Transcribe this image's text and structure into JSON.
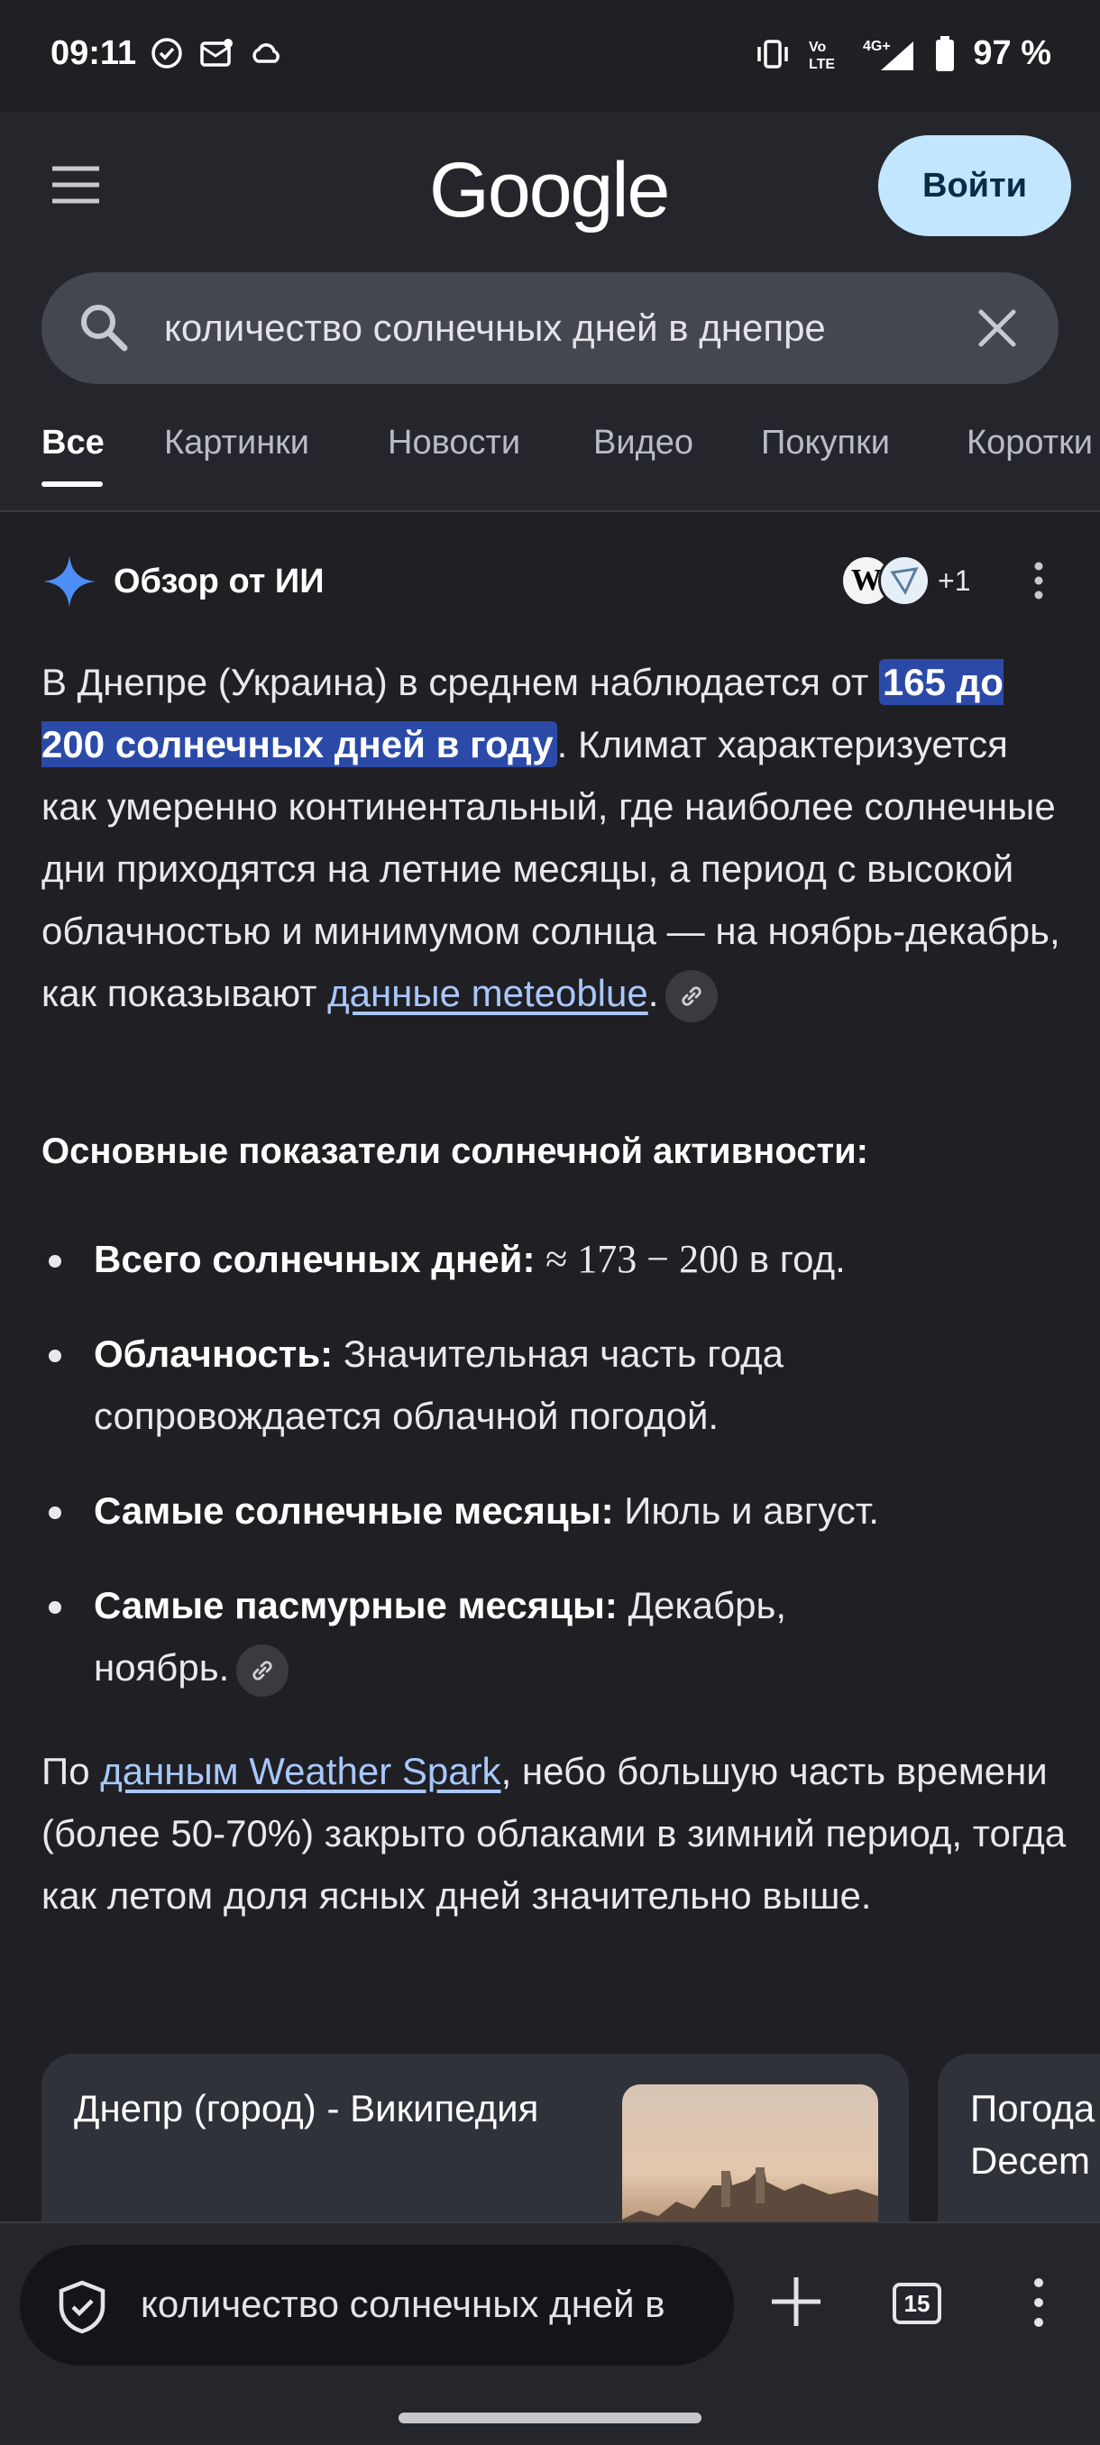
{
  "status_bar": {
    "time": "09:11",
    "battery": "97 %",
    "network": "4G+",
    "volte": "Vo LTE"
  },
  "header": {
    "logo": "Google",
    "signin_label": "Войти"
  },
  "search": {
    "query": "количество солнечных дней в днепре"
  },
  "tabs": [
    {
      "label": "Все",
      "active": true
    },
    {
      "label": "Картинки"
    },
    {
      "label": "Новости"
    },
    {
      "label": "Видео"
    },
    {
      "label": "Покупки"
    },
    {
      "label": "Коротки"
    }
  ],
  "ai_overview": {
    "title": "Обзор от ИИ",
    "sources_more": "+1",
    "intro_before": "В Днепре (Украина) в среднем наблюдается от ",
    "intro_highlight": "165 до 200 солнечных дней в году",
    "intro_after": ". Климат характеризуется как умеренно континентальный, где наиболее солнечные дни приходятся на летние месяцы, а период с высокой облачностью и минимумом солнца — на ноябрь-декабрь, как показывают ",
    "intro_link": "данные meteoblue",
    "intro_end": ".",
    "subheading": "Основные показатели солнечной активности:",
    "bullets": [
      {
        "bold": "Всего солнечных дней:",
        "math": "≈ 173 − 200",
        "text": " в год."
      },
      {
        "bold": "Облачность:",
        "text": " Значительная часть года сопровождается облачной погодой."
      },
      {
        "bold": "Самые солнечные месяцы:",
        "text": " Июль и август."
      },
      {
        "bold": "Самые пасмурные месяцы:",
        "text": " Декабрь, ноябрь."
      }
    ],
    "para2_before": "По ",
    "para2_link": "данным Weather Spark",
    "para2_after": ", небо большую часть времени (более 50-70%) закрыто облаками в зимний период, тогда как летом доля ясных дней значительно выше."
  },
  "cards": [
    {
      "title": "Днепр (город) - Википедия"
    },
    {
      "title": "Погода Decem"
    }
  ],
  "bottom_bar": {
    "omnibox_text": "количество солнечных дней в",
    "tab_count": "15"
  }
}
